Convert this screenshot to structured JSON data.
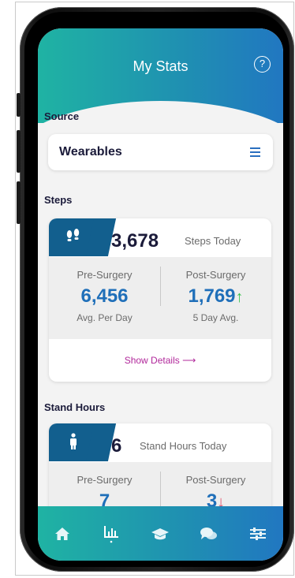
{
  "header": {
    "title": "My Stats",
    "help": "?"
  },
  "source": {
    "heading": "Source",
    "value": "Wearables"
  },
  "steps": {
    "heading": "Steps",
    "today_value": "3,678",
    "today_label": "Steps Today",
    "pre_label": "Pre-Surgery",
    "pre_value": "6,456",
    "pre_sub": "Avg. Per Day",
    "post_label": "Post-Surgery",
    "post_value": "1,769",
    "post_trend": "↑",
    "post_sub": "5 Day Avg.",
    "details_label": "Show Details ⟶"
  },
  "stand": {
    "heading": "Stand Hours",
    "today_value": "6",
    "today_label": "Stand Hours Today",
    "pre_label": "Pre-Surgery",
    "pre_value": "7",
    "post_label": "Post-Surgery",
    "post_value": "3",
    "post_trend": "↓"
  },
  "tabs": [
    {
      "icon": "home-icon",
      "glyph": "⌂"
    },
    {
      "icon": "stats-icon",
      "glyph": "▥"
    },
    {
      "icon": "education-icon",
      "glyph": "🎓"
    },
    {
      "icon": "chat-icon",
      "glyph": "💬"
    },
    {
      "icon": "settings-sliders-icon",
      "glyph": "☰"
    }
  ],
  "colors": {
    "accent": "#1f8fb2",
    "brand_dark": "#125f8e",
    "link": "#b1289b",
    "value": "#1f6fb9"
  }
}
